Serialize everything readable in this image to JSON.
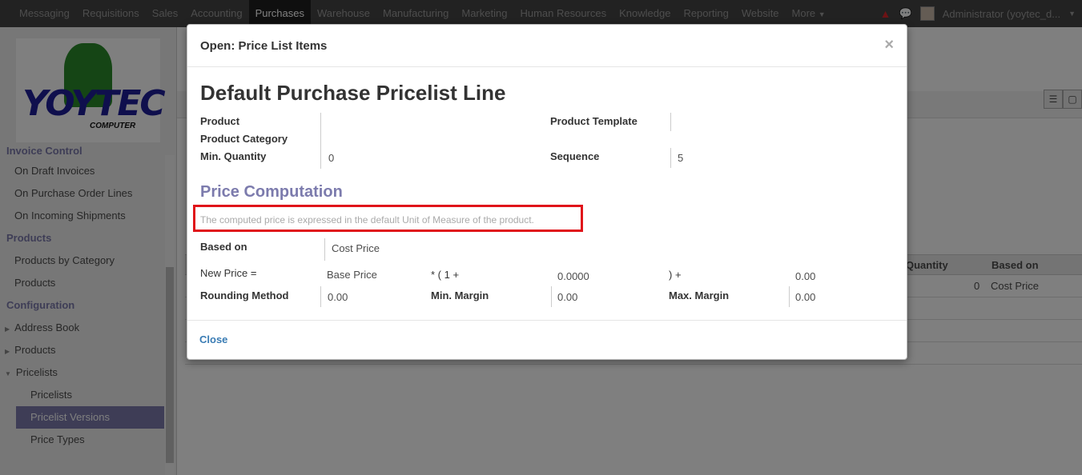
{
  "navbar": {
    "menu": [
      "Messaging",
      "Requisitions",
      "Sales",
      "Accounting",
      "Purchases",
      "Warehouse",
      "Manufacturing",
      "Marketing",
      "Human Resources",
      "Knowledge",
      "Reporting",
      "Website",
      "More"
    ],
    "active": "Purchases",
    "user": "Administrator (yoytec_d..."
  },
  "logo": {
    "text": "YOYTEC",
    "sub": "COMPUTER"
  },
  "sidebar": {
    "sections": [
      {
        "title": "Invoice Control",
        "items": [
          "On Draft Invoices",
          "On Purchase Order Lines",
          "On Incoming Shipments"
        ]
      },
      {
        "title": "Products",
        "items": [
          "Products by Category",
          "Products"
        ]
      },
      {
        "title": "Configuration",
        "items": [
          "Address Book",
          "Products",
          "Pricelists"
        ]
      }
    ],
    "pricelist_sub": [
      "Pricelists",
      "Pricelist Versions",
      "Price Types"
    ],
    "selected": "Pricelist Versions"
  },
  "background_table": {
    "headers": [
      "Quantity",
      "Based on"
    ],
    "row": {
      "quantity": "0",
      "based_on": "Cost Price"
    }
  },
  "modal": {
    "title": "Open: Price List Items",
    "close_x": "×",
    "form_title": "Default Purchase Pricelist Line",
    "fields": {
      "product_label": "Product",
      "product_value": "",
      "product_template_label": "Product Template",
      "product_template_value": "",
      "product_category_label": "Product Category",
      "min_quantity_label": "Min. Quantity",
      "min_quantity_value": "0",
      "sequence_label": "Sequence",
      "sequence_value": "5"
    },
    "price_computation": {
      "title": "Price Computation",
      "note": "The computed price is expressed in the default Unit of Measure of the product.",
      "based_on_label": "Based on",
      "based_on_value": "Cost Price",
      "new_price_label": "New Price =",
      "base_price": "Base Price",
      "multiplier_label": "* ( 1 +",
      "discount_value": "0.0000",
      "plus_label": ") +",
      "surcharge_value": "0.00",
      "rounding_label": "Rounding Method",
      "rounding_value": "0.00",
      "min_margin_label": "Min. Margin",
      "min_margin_value": "0.00",
      "max_margin_label": "Max. Margin",
      "max_margin_value": "0.00"
    },
    "footer_close": "Close"
  }
}
